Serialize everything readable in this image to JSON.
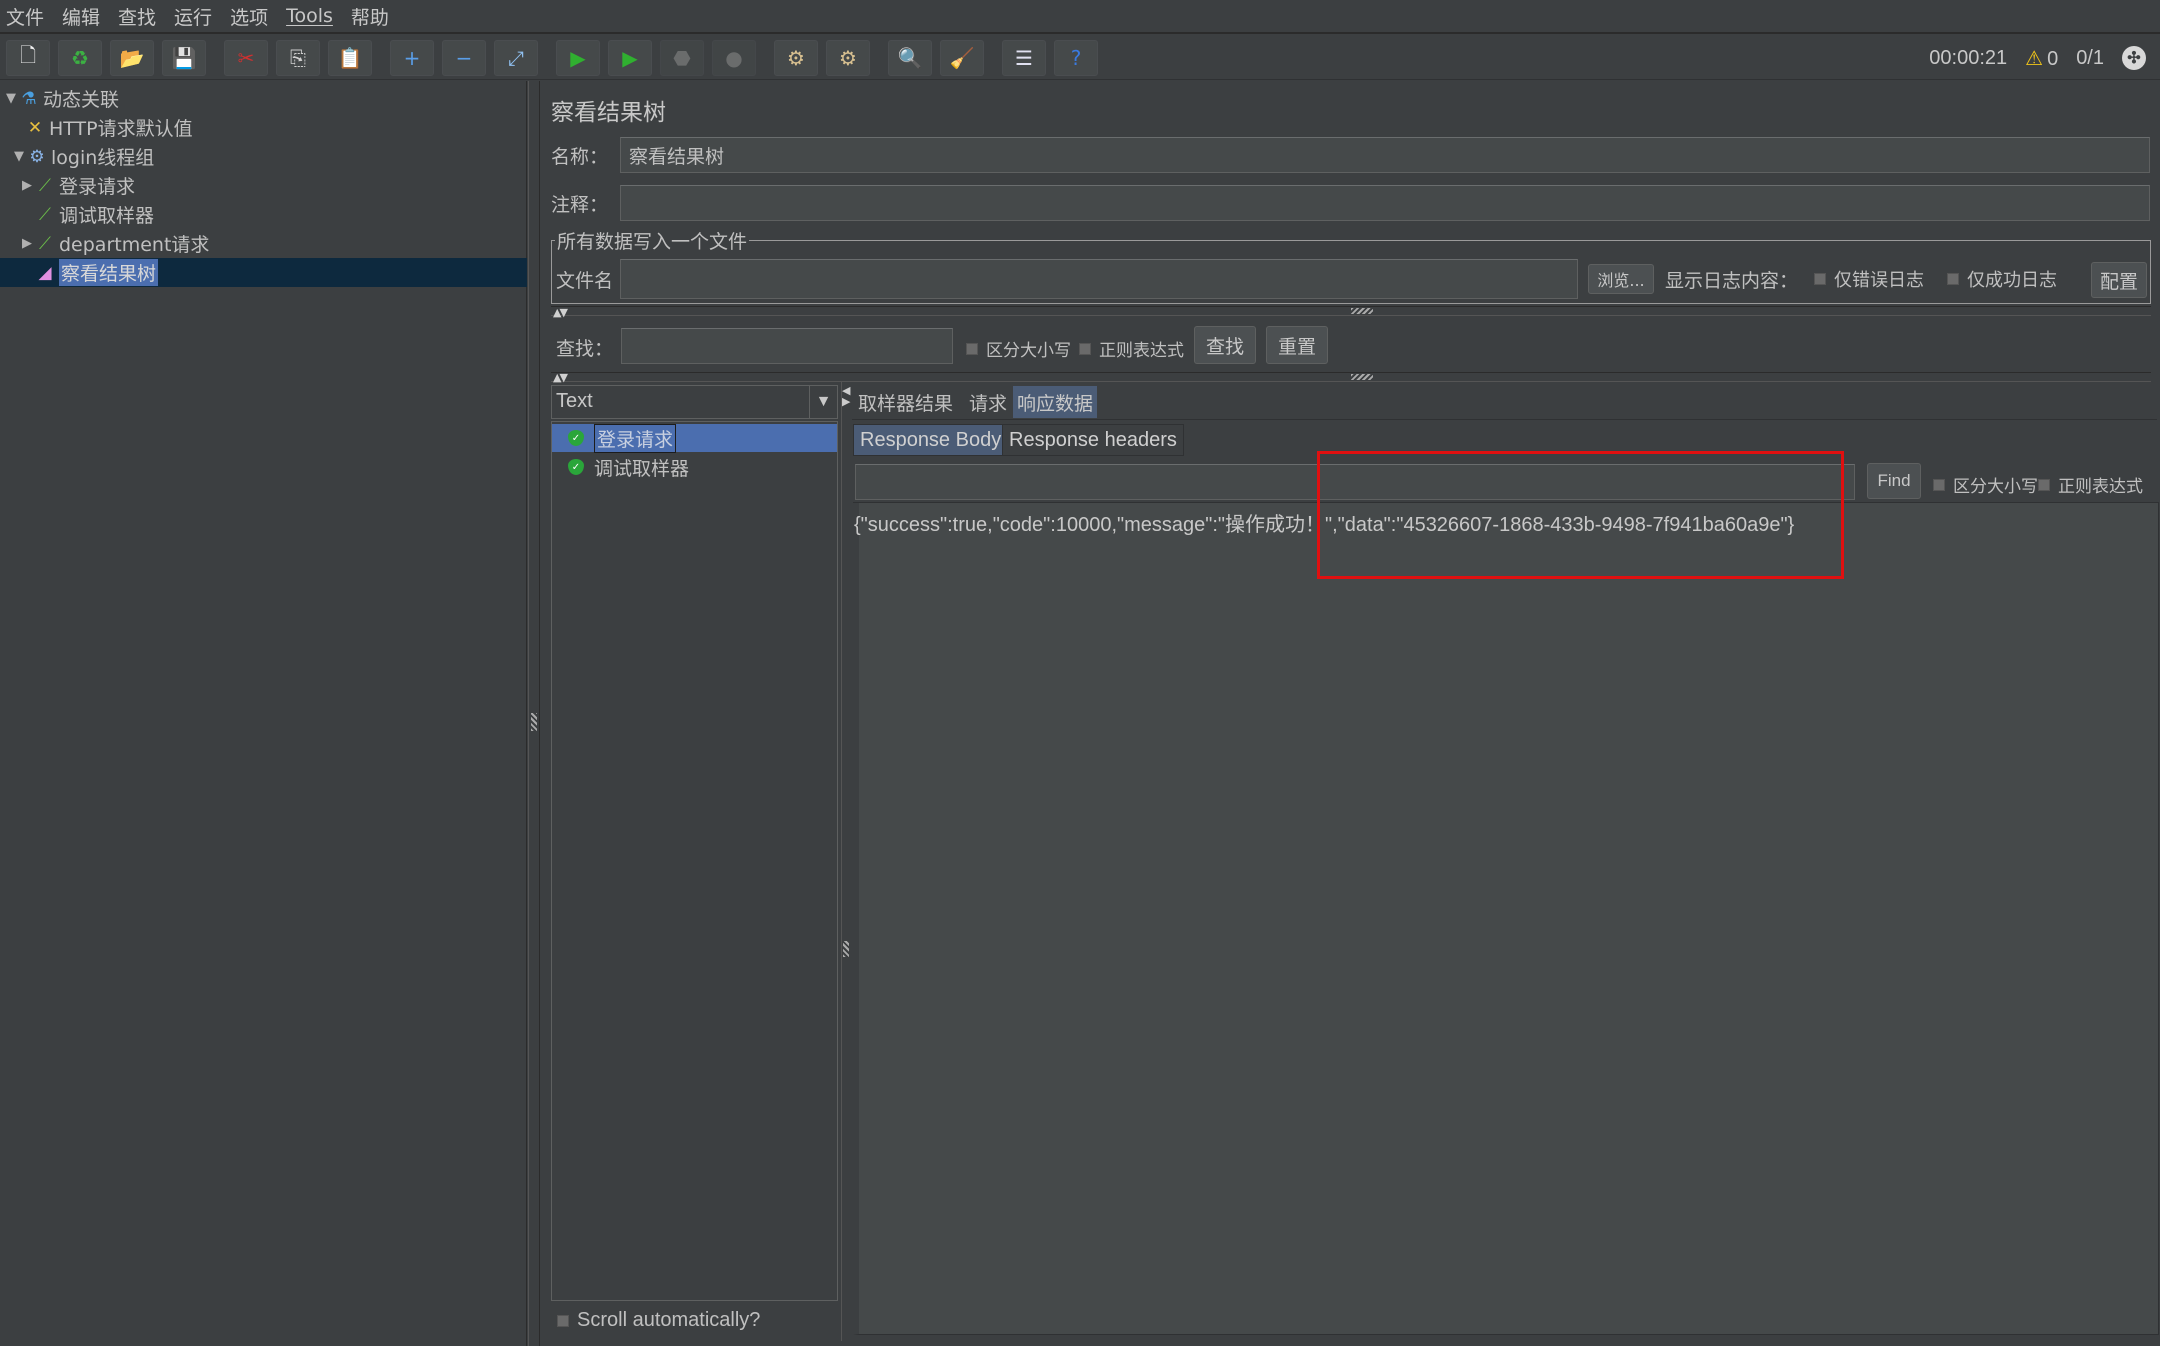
{
  "menu": {
    "items": [
      "文件",
      "编辑",
      "查找",
      "运行",
      "选项",
      "Tools",
      "帮助"
    ]
  },
  "toolbar": {
    "buttons": [
      {
        "name": "new-icon",
        "glyph": "🗋"
      },
      {
        "name": "templates-icon",
        "glyph": "♻"
      },
      {
        "name": "open-icon",
        "glyph": "📂"
      },
      {
        "name": "save-icon",
        "glyph": "💾"
      },
      {
        "name": "cut-icon",
        "glyph": "✂"
      },
      {
        "name": "copy-icon",
        "glyph": "⎘"
      },
      {
        "name": "paste-icon",
        "glyph": "📋"
      },
      {
        "name": "expand-icon",
        "glyph": "+"
      },
      {
        "name": "collapse-icon",
        "glyph": "−"
      },
      {
        "name": "toggle-icon",
        "glyph": "⤢"
      },
      {
        "name": "start-icon",
        "glyph": "▶"
      },
      {
        "name": "start-no-pause-icon",
        "glyph": "▶"
      },
      {
        "name": "stop-icon",
        "glyph": "⬣"
      },
      {
        "name": "shutdown-icon",
        "glyph": "●"
      },
      {
        "name": "clear-icon",
        "glyph": "⚙"
      },
      {
        "name": "clear-all-icon",
        "glyph": "⚙"
      },
      {
        "name": "search-icon",
        "glyph": "🔍"
      },
      {
        "name": "reset-search-icon",
        "glyph": "🧹"
      },
      {
        "name": "function-helper-icon",
        "glyph": "☰"
      },
      {
        "name": "help-icon",
        "glyph": "?"
      }
    ]
  },
  "status": {
    "elapsed_time": "00:00:21",
    "warnings": "0",
    "threads": "0/1"
  },
  "tree": {
    "items": [
      {
        "label": "动态关联",
        "icon": "flask-icon",
        "glyph": "⚗",
        "expanded": true
      },
      {
        "label": "HTTP请求默认值",
        "icon": "config-icon",
        "glyph": "✕"
      },
      {
        "label": "login线程组",
        "icon": "thread-group-icon",
        "glyph": "⚙",
        "expanded": true
      },
      {
        "label": "登录请求",
        "icon": "sampler-icon",
        "glyph": "⁄",
        "collapsed": true
      },
      {
        "label": "调试取样器",
        "icon": "sampler-icon",
        "glyph": "⁄"
      },
      {
        "label": "department请求",
        "icon": "sampler-icon",
        "glyph": "⁄",
        "collapsed": true
      },
      {
        "label": "察看结果树",
        "icon": "listener-icon",
        "glyph": "◢",
        "selected": true
      }
    ]
  },
  "panel": {
    "title": "察看结果树",
    "name_label": "名称：",
    "name_value": "察看结果树",
    "comment_label": "注释：",
    "comment_value": "",
    "file_group_title": "所有数据写入一个文件",
    "filename_label": "文件名",
    "filename_value": "",
    "browse_button": "浏览...",
    "log_content_label": "显示日志内容：",
    "errors_only_label": "仅错误日志",
    "success_only_label": "仅成功日志",
    "configure_button": "配置",
    "search_label": "查找：",
    "search_value": "",
    "case_sensitive_label": "区分大小写",
    "regex_label": "正则表达式",
    "find_button": "查找",
    "reset_button": "重置"
  },
  "results": {
    "renderer": "Text",
    "items": [
      {
        "label": "登录请求",
        "status": "success",
        "selected": true
      },
      {
        "label": "调试取样器",
        "status": "success"
      }
    ],
    "scroll_auto_label": "Scroll automatically?"
  },
  "tabs": {
    "main": [
      {
        "label": "取样器结果"
      },
      {
        "label": "请求"
      },
      {
        "label": "响应数据",
        "active": true
      }
    ],
    "sub": [
      {
        "label": "Response Body",
        "active": true
      },
      {
        "label": "Response headers"
      }
    ]
  },
  "response": {
    "search_value": "",
    "find_button": "Find",
    "case_sensitive_label": "区分大小写",
    "regex_label": "正则表达式",
    "body": "{\"success\":true,\"code\":10000,\"message\":\"操作成功！\",\"data\":\"45326607-1868-433b-9498-7f941ba60a9e\"}",
    "highlight_color": "#e01010"
  }
}
